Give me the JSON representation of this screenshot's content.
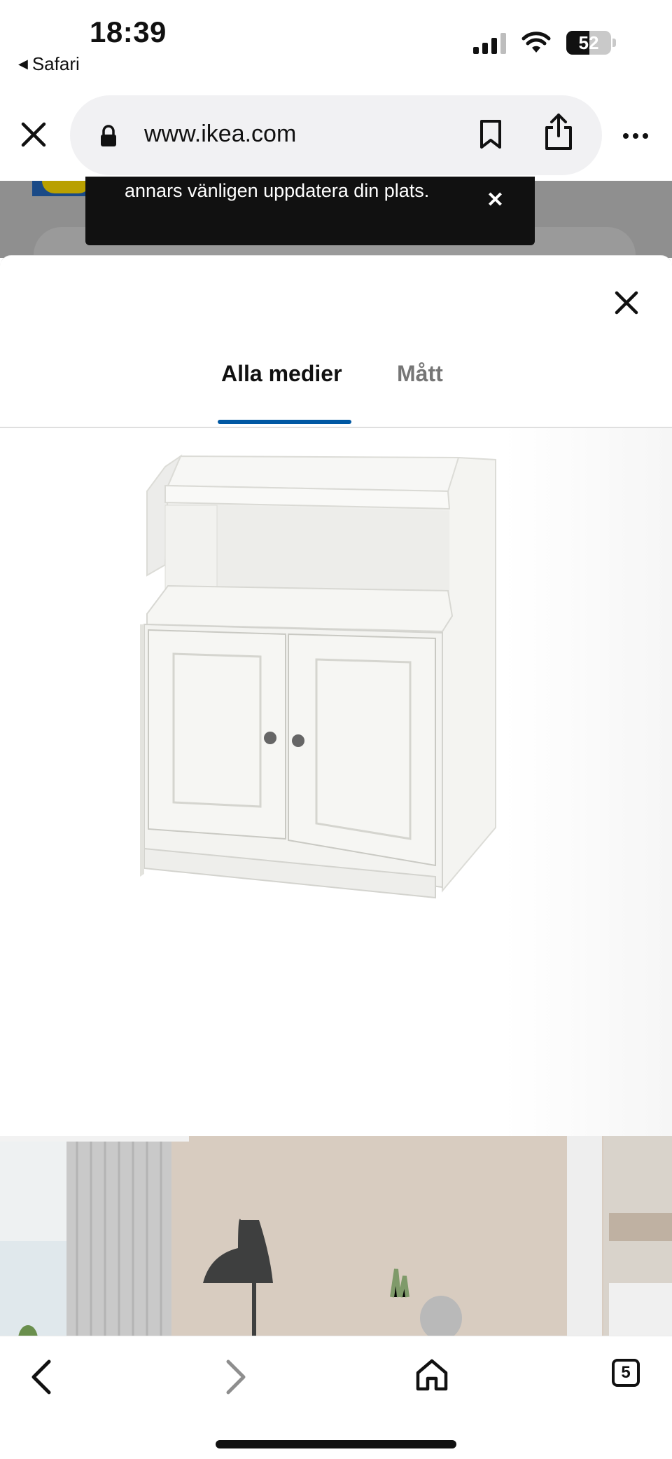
{
  "status_bar": {
    "time": "18:39",
    "back_app": "Safari",
    "battery_percent": "52",
    "battery_level": 0.52,
    "icons": [
      "cellular-signal-icon",
      "wifi-icon",
      "battery-icon"
    ]
  },
  "browser": {
    "url": "www.ikea.com",
    "icons": [
      "close-icon",
      "lock-icon",
      "bookmark-icon",
      "share-icon",
      "more-icon"
    ]
  },
  "toast": {
    "text": "annars vänligen uppdatera din plats.",
    "close_icon": "close-icon"
  },
  "sheet": {
    "tabs": [
      {
        "label": "Alla medier",
        "active": true
      },
      {
        "label": "Mått",
        "active": false
      }
    ],
    "accent_color": "#0058a3"
  },
  "toolbar": {
    "tab_count": "5",
    "icons": [
      "back-icon",
      "forward-icon",
      "home-icon",
      "tabs-icon"
    ]
  }
}
